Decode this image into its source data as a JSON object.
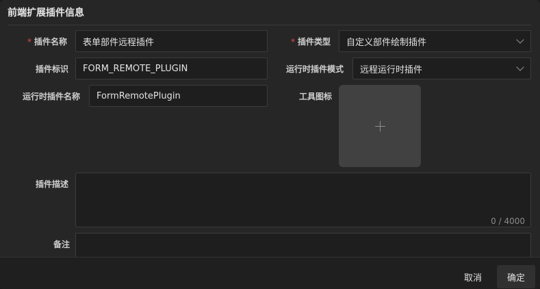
{
  "dialog": {
    "title": "前端扩展插件信息"
  },
  "form": {
    "plugin_name": {
      "label": "插件名称",
      "required": true,
      "value": "表单部件远程插件"
    },
    "plugin_type": {
      "label": "插件类型",
      "required": true,
      "value": "自定义部件绘制插件"
    },
    "plugin_id": {
      "label": "插件标识",
      "value": "FORM_REMOTE_PLUGIN"
    },
    "runtime_mode": {
      "label": "运行时插件模式",
      "value": "远程运行时插件"
    },
    "runtime_name": {
      "label": "运行时插件名称",
      "value": "FormRemotePlugin"
    },
    "tool_icon": {
      "label": "工具图标"
    },
    "description": {
      "label": "插件描述",
      "value": "",
      "counter": "0 / 4000"
    },
    "remark": {
      "label": "备注",
      "value": ""
    }
  },
  "footer": {
    "cancel_label": "取消",
    "ok_label": "确定"
  },
  "colors": {
    "background": "#262626",
    "field": "#1e1e1e",
    "required": "#e24a4a"
  },
  "icons": {
    "select_arrow": "chevron-down-icon",
    "upload": "plus-icon"
  }
}
